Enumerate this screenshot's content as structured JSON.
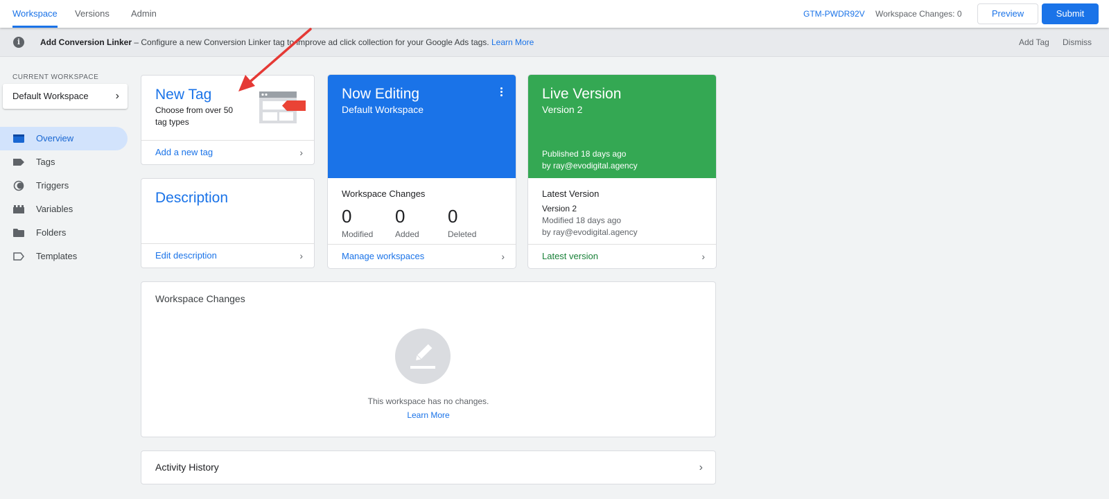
{
  "topbar": {
    "tabs": [
      {
        "label": "Workspace",
        "active": true
      },
      {
        "label": "Versions",
        "active": false
      },
      {
        "label": "Admin",
        "active": false
      }
    ],
    "container_id": "GTM-PWDR92V",
    "workspace_changes": "Workspace Changes: 0",
    "preview_label": "Preview",
    "submit_label": "Submit"
  },
  "notification": {
    "title": "Add Conversion Linker",
    "message": " – Configure a new Conversion Linker tag to improve ad click collection for your Google Ads tags. ",
    "link": "Learn More",
    "add_tag": "Add Tag",
    "dismiss": "Dismiss"
  },
  "sidebar": {
    "current_workspace_label": "CURRENT WORKSPACE",
    "workspace_name": "Default Workspace",
    "items": [
      {
        "label": "Overview",
        "icon": "overview-icon",
        "active": true
      },
      {
        "label": "Tags",
        "icon": "tag-icon",
        "active": false
      },
      {
        "label": "Triggers",
        "icon": "trigger-icon",
        "active": false
      },
      {
        "label": "Variables",
        "icon": "variables-icon",
        "active": false
      },
      {
        "label": "Folders",
        "icon": "folder-icon",
        "active": false
      },
      {
        "label": "Templates",
        "icon": "template-icon",
        "active": false
      }
    ]
  },
  "new_tag": {
    "title": "New Tag",
    "subtitle_line1": "Choose from over 50",
    "subtitle_line2": "tag types",
    "link": "Add a new tag"
  },
  "description": {
    "title": "Description",
    "link": "Edit description"
  },
  "now_editing": {
    "title": "Now Editing",
    "workspace": "Default Workspace",
    "color": "#1a73e8",
    "changes_title": "Workspace Changes",
    "stats": [
      {
        "value": "0",
        "label": "Modified"
      },
      {
        "value": "0",
        "label": "Added"
      },
      {
        "value": "0",
        "label": "Deleted"
      }
    ],
    "link": "Manage workspaces"
  },
  "live_version": {
    "title": "Live Version",
    "version": "Version 2",
    "published": "Published 18 days ago",
    "by": "by ray@evodigital.agency",
    "color": "#34a853",
    "latest_title": "Latest Version",
    "latest_version": "Version 2",
    "modified": "Modified 18 days ago",
    "latest_by": "by ray@evodigital.agency",
    "link": "Latest version"
  },
  "workspace_changes_card": {
    "title": "Workspace Changes",
    "empty_text": "This workspace has no changes.",
    "link": "Learn More"
  },
  "activity_history": {
    "title": "Activity History"
  }
}
